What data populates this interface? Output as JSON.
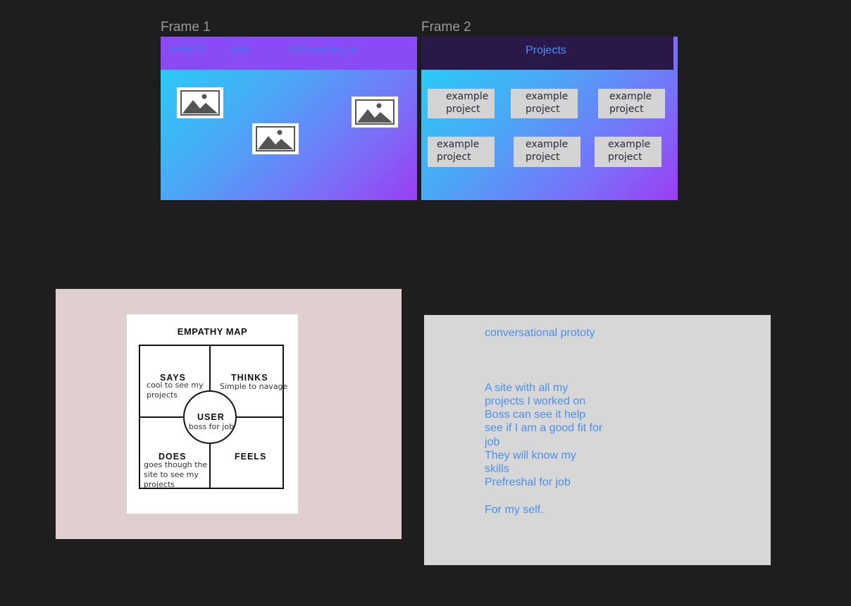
{
  "canvas": {
    "frame1_label": "Frame 1",
    "frame2_label": "Frame 2"
  },
  "frame1": {
    "nav": {
      "projects": "projects",
      "skills": "skills",
      "still_working": "Still working on"
    },
    "placeholders": [
      "image-placeholder-icon",
      "image-placeholder-icon",
      "image-placeholder-icon"
    ]
  },
  "frame2": {
    "title": "Projects",
    "cards": [
      {
        "line1": "example",
        "line2": "project"
      },
      {
        "line1": "example",
        "line2": "project"
      },
      {
        "line1": "example",
        "line2": "project"
      },
      {
        "line1": "example",
        "line2": "project"
      },
      {
        "line1": "example",
        "line2": "project"
      },
      {
        "line1": "example",
        "line2": "project"
      }
    ]
  },
  "empathy_map": {
    "title": "EMPATHY MAP",
    "says": {
      "label": "SAYS",
      "note1": "cool to see my",
      "note2": "projects"
    },
    "thinks": {
      "label": "THINKS",
      "note": "Simple to navage"
    },
    "user": {
      "label": "USER",
      "note": "boss for job"
    },
    "does": {
      "label": "DOES",
      "note1": "goes though the",
      "note2": "site to see my",
      "note3": "projects"
    },
    "feels": {
      "label": "FEELS"
    }
  },
  "notes": {
    "heading": "conversational prototy",
    "lines": [
      "A site with all my",
      "projects I worked on",
      "Boss can see it help",
      "see if I am a good fit for",
      "job",
      "They will know my",
      "skills",
      "Prefreshal for job",
      "",
      "For my self."
    ]
  },
  "colors": {
    "canvas_bg": "#1e1e1e",
    "nav_purple": "#8a4af5",
    "nav_dark": "#291848",
    "link_blue": "#4a90e8",
    "empathy_panel": "#e0cfcf",
    "notes_panel": "#d7d7d7"
  }
}
